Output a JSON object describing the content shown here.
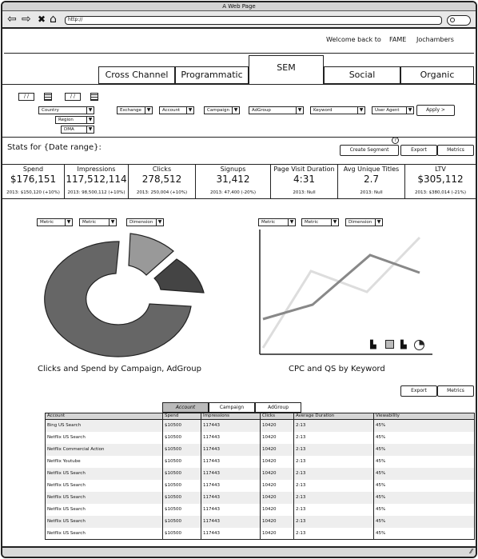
{
  "window": {
    "title": "A Web Page"
  },
  "browser": {
    "url": "http://"
  },
  "header": {
    "welcome": "Welcome back to",
    "brand": "FAME",
    "user": "Jochambers"
  },
  "tabs": [
    {
      "label": "Cross Channel"
    },
    {
      "label": "Programmatic"
    },
    {
      "label": "SEM"
    },
    {
      "label": "Social"
    },
    {
      "label": "Organic"
    }
  ],
  "filters": {
    "date_start": "/ /",
    "date_end": "/ /",
    "country": "Country",
    "region": "Region",
    "dma": "DMA",
    "exchange": "Exchange",
    "account": "Account",
    "campaign": "Campaign",
    "adgroup": "AdGroup",
    "keyword": "Keyword",
    "user_agent": "User Agent",
    "apply": "Apply >"
  },
  "stats_bar": {
    "title": "Stats for {Date range}:",
    "create_segment": "Create Segment",
    "help": "?",
    "export": "Export",
    "metrics": "Metrics"
  },
  "stats": [
    {
      "label": "Spend",
      "value": "$176,151",
      "compare": "2013: $150,120 (+10%)"
    },
    {
      "label": "Impressions",
      "value": "117,512,114",
      "compare": "2013: 98,500,112 (+10%)"
    },
    {
      "label": "Clicks",
      "value": "278,512",
      "compare": "2013: 250,004 (+10%)"
    },
    {
      "label": "Signups",
      "value": "31,412",
      "compare": "2013: 47,400 (-20%)"
    },
    {
      "label": "Page Visit Duration",
      "value": "4:31",
      "compare": "2013: Null"
    },
    {
      "label": "Avg Unique Titles",
      "value": "2.7",
      "compare": "2013: Null"
    },
    {
      "label": "LTV",
      "value": "$305,112",
      "compare": "2013: $380,014 (-21%)"
    }
  ],
  "charts": {
    "left": {
      "metric1": "Metric",
      "metric2": "Metric",
      "dimension": "Dimension",
      "caption": "Clicks and Spend by Campaign, AdGroup"
    },
    "right": {
      "metric1": "Metric",
      "metric2": "Metric",
      "dimension": "Dimension",
      "caption": "CPC and QS by Keyword"
    }
  },
  "table_controls": {
    "export": "Export",
    "metrics": "Metrics"
  },
  "table_tabs": [
    {
      "label": "Account"
    },
    {
      "label": "Campaign"
    },
    {
      "label": "AdGroup"
    }
  ],
  "table": {
    "columns": [
      "Account",
      "Spend",
      "Impressions",
      "Clicks",
      "Average Duration",
      "Viewability"
    ],
    "rows": [
      [
        "Bing US Search",
        "$10500",
        "117443",
        "10420",
        "2:13",
        "45%"
      ],
      [
        "Netflix US Search",
        "$10500",
        "117443",
        "10420",
        "2:13",
        "45%"
      ],
      [
        "Netflix Commercial Action",
        "$10500",
        "117443",
        "10420",
        "2:13",
        "45%"
      ],
      [
        "Netflix Youtube",
        "$10500",
        "117443",
        "10420",
        "2:13",
        "45%"
      ],
      [
        "Netflix US Search",
        "$10500",
        "117443",
        "10420",
        "2:13",
        "45%"
      ],
      [
        "Netflix US Search",
        "$10500",
        "117443",
        "10420",
        "2:13",
        "45%"
      ],
      [
        "Netflix US Search",
        "$10500",
        "117443",
        "10420",
        "2:13",
        "45%"
      ],
      [
        "Netflix US Search",
        "$10500",
        "117443",
        "10420",
        "2:13",
        "45%"
      ],
      [
        "Netflix US Search",
        "$10500",
        "117443",
        "10420",
        "2:13",
        "45%"
      ],
      [
        "Netflix US Search",
        "$10500",
        "117443",
        "10420",
        "2:13",
        "45%"
      ]
    ]
  },
  "colors": {
    "donut_dark": "#444444",
    "donut_mid": "#666666",
    "donut_light": "#999999",
    "line_dark": "#888888",
    "line_light": "#dddddd"
  }
}
